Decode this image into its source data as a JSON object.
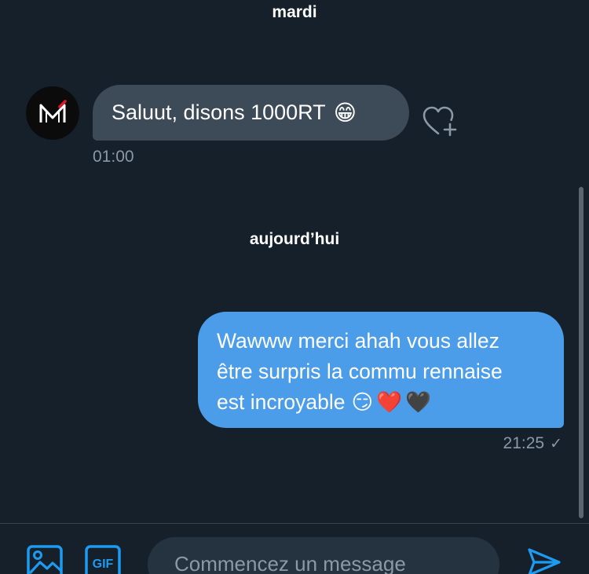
{
  "conversation": {
    "day_separators": [
      "mardi",
      "aujourd’hui"
    ],
    "messages": [
      {
        "direction": "received",
        "text": "Saluut, disons 1000RT",
        "emoji": "😁",
        "time": "01:00"
      },
      {
        "direction": "sent",
        "lines": [
          "Wawww merci ahah vous allez",
          "être surpris la commu rennaise",
          "est incroyable"
        ],
        "emojis": "😏❤️🖤",
        "time": "21:25",
        "status": "✓"
      }
    ]
  },
  "composer": {
    "placeholder": "Commencez un message",
    "gif_label": "GIF"
  },
  "colors": {
    "background": "#15202b",
    "received_bubble": "#3d4a57",
    "sent_bubble": "#4b9ce9",
    "accent": "#1d9bf0",
    "muted_text": "#8b98a5"
  },
  "icons": [
    "avatar-logo",
    "heart-add-icon",
    "image-icon",
    "gif-icon",
    "send-icon"
  ]
}
